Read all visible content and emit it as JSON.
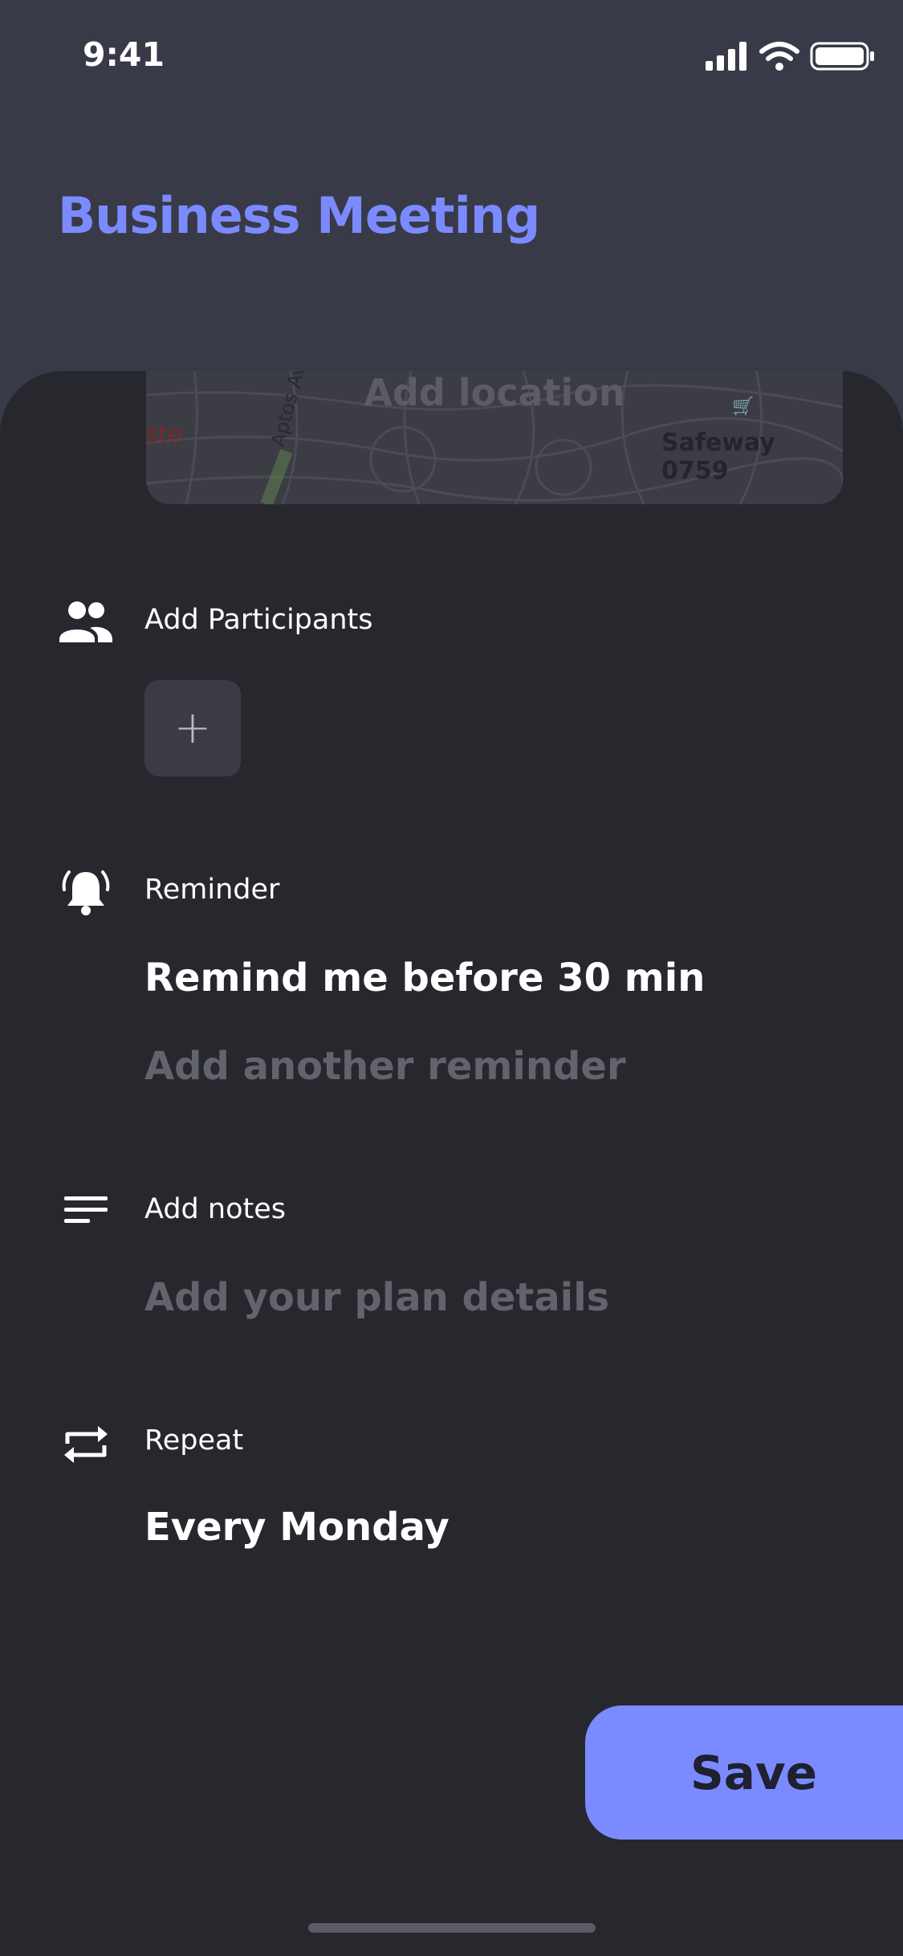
{
  "status_bar": {
    "time": "9:41"
  },
  "header": {
    "title": "Business Meeting"
  },
  "location": {
    "placeholder": "Add location",
    "map_labels": {
      "street": "Aptos Ave",
      "store": "Safeway 0759",
      "left_fragment": "ste"
    }
  },
  "participants": {
    "label": "Add Participants",
    "add_symbol": "+"
  },
  "reminder": {
    "label": "Reminder",
    "value": "Remind me before 30 min",
    "add_another": "Add another reminder"
  },
  "notes": {
    "label": "Add notes",
    "placeholder": "Add your plan details"
  },
  "repeat": {
    "label": "Repeat",
    "value": "Every Monday"
  },
  "actions": {
    "save_label": "Save"
  },
  "colors": {
    "accent": "#7B8BFF",
    "header_bg": "#393A47",
    "sheet_bg": "#27282E",
    "placeholder_text": "#62636B"
  },
  "icons": {
    "participants": "group-icon",
    "reminder": "bell-ringing-icon",
    "notes": "notes-lines-icon",
    "repeat": "repeat-icon"
  }
}
